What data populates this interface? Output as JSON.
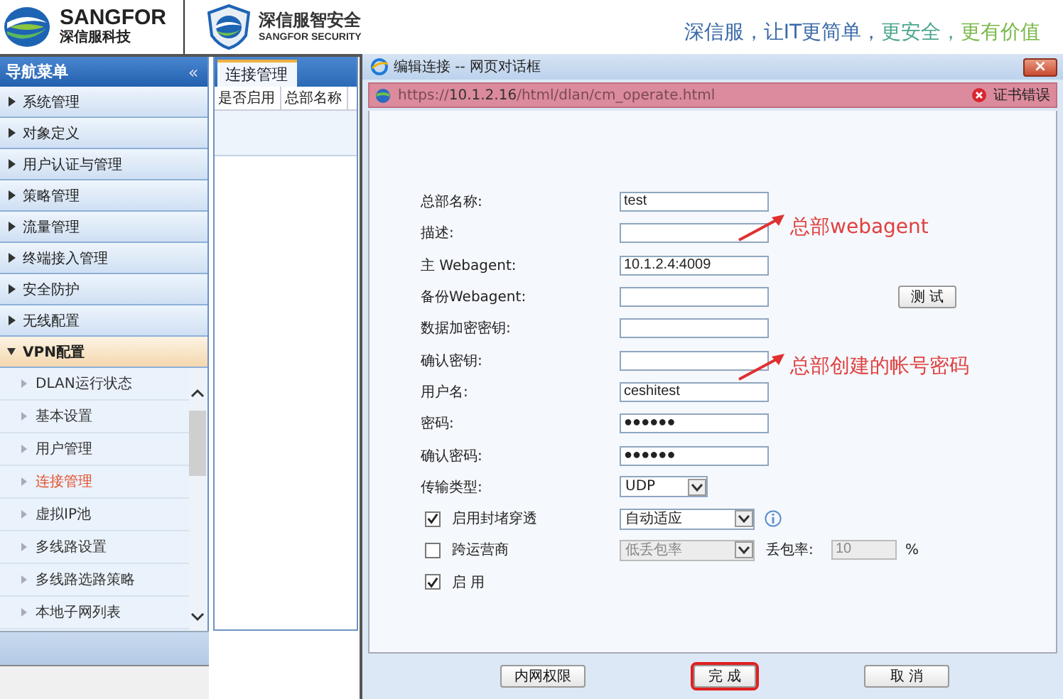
{
  "header": {
    "brand": {
      "name": "SANGFOR",
      "sub": "深信服科技"
    },
    "brand2": {
      "name": "深信服智安全",
      "sub": "SANGFOR SECURITY"
    },
    "slogan": [
      {
        "text": "深信服，让IT更简单，",
        "color": "#3a6aa8"
      },
      {
        "text": "更安全，",
        "color": "#4aa58e"
      },
      {
        "text": "更有价值",
        "color": "#79b84a"
      }
    ]
  },
  "sidebar": {
    "title": "导航菜单",
    "collapse": "«",
    "items": [
      {
        "label": "系统管理",
        "expanded": false
      },
      {
        "label": "对象定义",
        "expanded": false
      },
      {
        "label": "用户认证与管理",
        "expanded": false
      },
      {
        "label": "策略管理",
        "expanded": false
      },
      {
        "label": "流量管理",
        "expanded": false
      },
      {
        "label": "终端接入管理",
        "expanded": false
      },
      {
        "label": "安全防护",
        "expanded": false
      },
      {
        "label": "无线配置",
        "expanded": false
      },
      {
        "label": "VPN配置",
        "expanded": true,
        "children": [
          {
            "label": "DLAN运行状态",
            "selected": false
          },
          {
            "label": "基本设置",
            "selected": false
          },
          {
            "label": "用户管理",
            "selected": false
          },
          {
            "label": "连接管理",
            "selected": true
          },
          {
            "label": "虚拟IP池",
            "selected": false
          },
          {
            "label": "多线路设置",
            "selected": false
          },
          {
            "label": "多线路选路策略",
            "selected": false
          },
          {
            "label": "本地子网列表",
            "selected": false
          }
        ]
      }
    ]
  },
  "panel": {
    "tabs": [
      {
        "label": "连接管理",
        "selected": true
      }
    ],
    "columns": [
      "是否启用",
      "总部名称"
    ]
  },
  "dialog": {
    "title": "编辑连接 -- 网页对话框",
    "close": "×",
    "url": "https://**10.1.2.16**/html/dlan/cm_operate.html",
    "cert_error": "证书错误",
    "rows": [
      {
        "kind": "text",
        "label": "总部名称:",
        "value": "test"
      },
      {
        "kind": "text",
        "label": "描述:",
        "value": ""
      },
      {
        "kind": "text",
        "label": "主 Webagent:",
        "value": "10.1.2.4:4009"
      },
      {
        "kind": "text",
        "label": "备份Webagent:",
        "value": "",
        "button": "测 试"
      },
      {
        "kind": "text",
        "label": "数据加密密钥:",
        "value": ""
      },
      {
        "kind": "text",
        "label": "确认密钥:",
        "value": ""
      },
      {
        "kind": "text",
        "label": "用户名:",
        "value": "ceshitest"
      },
      {
        "kind": "text",
        "label": "密码:",
        "value": "●●●●●●"
      },
      {
        "kind": "text",
        "label": "确认密码:",
        "value": "●●●●●●"
      },
      {
        "kind": "select",
        "label": "传输类型:",
        "value": "UDP"
      },
      {
        "kind": "check",
        "label": "启用封堵穿透",
        "checked": true,
        "select": "自动适应",
        "disabled": false,
        "info": true
      },
      {
        "kind": "check",
        "label": "跨运营商",
        "checked": false,
        "select": "低丢包率",
        "disabled": true,
        "extra_label": "丢包率:",
        "extra_value": "10",
        "unit": "%"
      },
      {
        "kind": "check",
        "label": "启 用",
        "checked": true
      }
    ],
    "buttons": [
      {
        "label": "内网权限",
        "highlighted": false
      },
      {
        "label": "完 成",
        "highlighted": true
      },
      {
        "label": "取 消",
        "highlighted": false
      }
    ]
  },
  "annotations": [
    {
      "text": "总部webagent"
    },
    {
      "text": "总部创建的帐号密码"
    }
  ]
}
